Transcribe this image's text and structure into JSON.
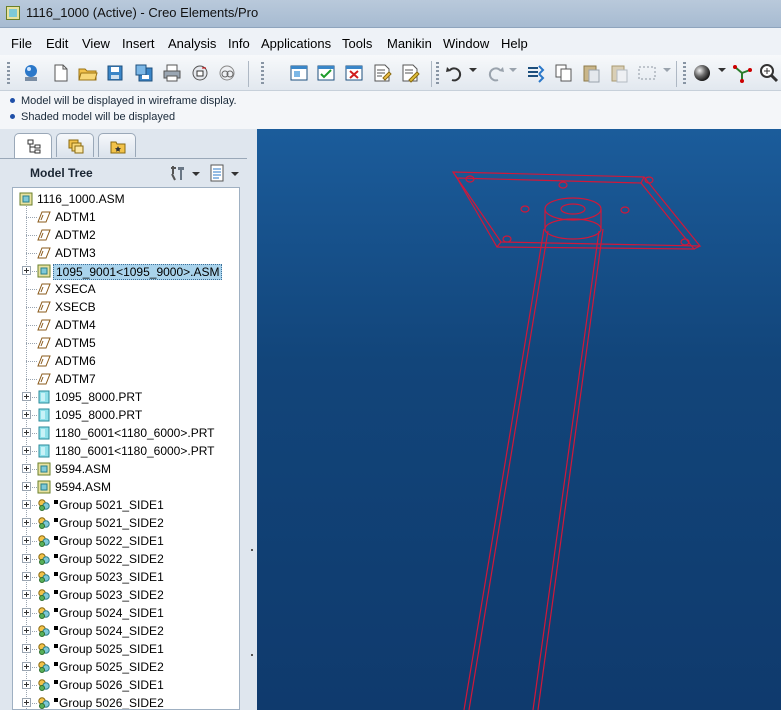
{
  "window": {
    "title": "1116_1000 (Active) - Creo Elements/Pro"
  },
  "menu": [
    "File",
    "Edit",
    "View",
    "Insert",
    "Analysis",
    "Info",
    "Applications",
    "Tools",
    "Manikin",
    "Window",
    "Help"
  ],
  "messages": [
    "Model will be displayed in wireframe display.",
    "Shaded model will be displayed"
  ],
  "navigator": {
    "tabs": [
      "model-tree-tab",
      "layer-tree-tab",
      "favorites-tab"
    ],
    "header": "Model Tree"
  },
  "tree": [
    {
      "label": "1116_1000.ASM",
      "type": "assembly",
      "level": 0,
      "expand": false
    },
    {
      "label": "ADTM1",
      "type": "datum",
      "level": 1,
      "expand": false
    },
    {
      "label": "ADTM2",
      "type": "datum",
      "level": 1,
      "expand": false
    },
    {
      "label": "ADTM3",
      "type": "datum",
      "level": 1,
      "expand": false
    },
    {
      "label": "1095_9001<1095_9000>.ASM",
      "type": "assembly",
      "level": 1,
      "expand": true,
      "selected": true
    },
    {
      "label": "XSECA",
      "type": "datum",
      "level": 1,
      "expand": false
    },
    {
      "label": "XSECB",
      "type": "datum",
      "level": 1,
      "expand": false
    },
    {
      "label": "ADTM4",
      "type": "datum",
      "level": 1,
      "expand": false
    },
    {
      "label": "ADTM5",
      "type": "datum",
      "level": 1,
      "expand": false
    },
    {
      "label": "ADTM6",
      "type": "datum",
      "level": 1,
      "expand": false
    },
    {
      "label": "ADTM7",
      "type": "datum",
      "level": 1,
      "expand": false
    },
    {
      "label": "1095_8000.PRT",
      "type": "part",
      "level": 1,
      "expand": true
    },
    {
      "label": "1095_8000.PRT",
      "type": "part",
      "level": 1,
      "expand": true
    },
    {
      "label": "1180_6001<1180_6000>.PRT",
      "type": "part",
      "level": 1,
      "expand": true
    },
    {
      "label": "1180_6001<1180_6000>.PRT",
      "type": "part",
      "level": 1,
      "expand": true
    },
    {
      "label": "9594.ASM",
      "type": "assembly",
      "level": 1,
      "expand": true
    },
    {
      "label": "9594.ASM",
      "type": "assembly",
      "level": 1,
      "expand": true
    },
    {
      "label": "Group 5021_SIDE1",
      "type": "group",
      "level": 1,
      "expand": true
    },
    {
      "label": "Group 5021_SIDE2",
      "type": "group",
      "level": 1,
      "expand": true
    },
    {
      "label": "Group 5022_SIDE1",
      "type": "group",
      "level": 1,
      "expand": true
    },
    {
      "label": "Group 5022_SIDE2",
      "type": "group",
      "level": 1,
      "expand": true
    },
    {
      "label": "Group 5023_SIDE1",
      "type": "group",
      "level": 1,
      "expand": true
    },
    {
      "label": "Group 5023_SIDE2",
      "type": "group",
      "level": 1,
      "expand": true
    },
    {
      "label": "Group 5024_SIDE1",
      "type": "group",
      "level": 1,
      "expand": true
    },
    {
      "label": "Group 5024_SIDE2",
      "type": "group",
      "level": 1,
      "expand": true
    },
    {
      "label": "Group 5025_SIDE1",
      "type": "group",
      "level": 1,
      "expand": true
    },
    {
      "label": "Group 5025_SIDE2",
      "type": "group",
      "level": 1,
      "expand": true
    },
    {
      "label": "Group 5026_SIDE1",
      "type": "group",
      "level": 1,
      "expand": true
    },
    {
      "label": "Group 5026_SIDE2",
      "type": "group",
      "level": 1,
      "expand": true
    }
  ],
  "colors": {
    "wireframe": "#d0183a",
    "graphics_bg_top": "#1b5c9b",
    "graphics_bg_bottom": "#0f3a6d",
    "selection": "#a9d3ec"
  }
}
